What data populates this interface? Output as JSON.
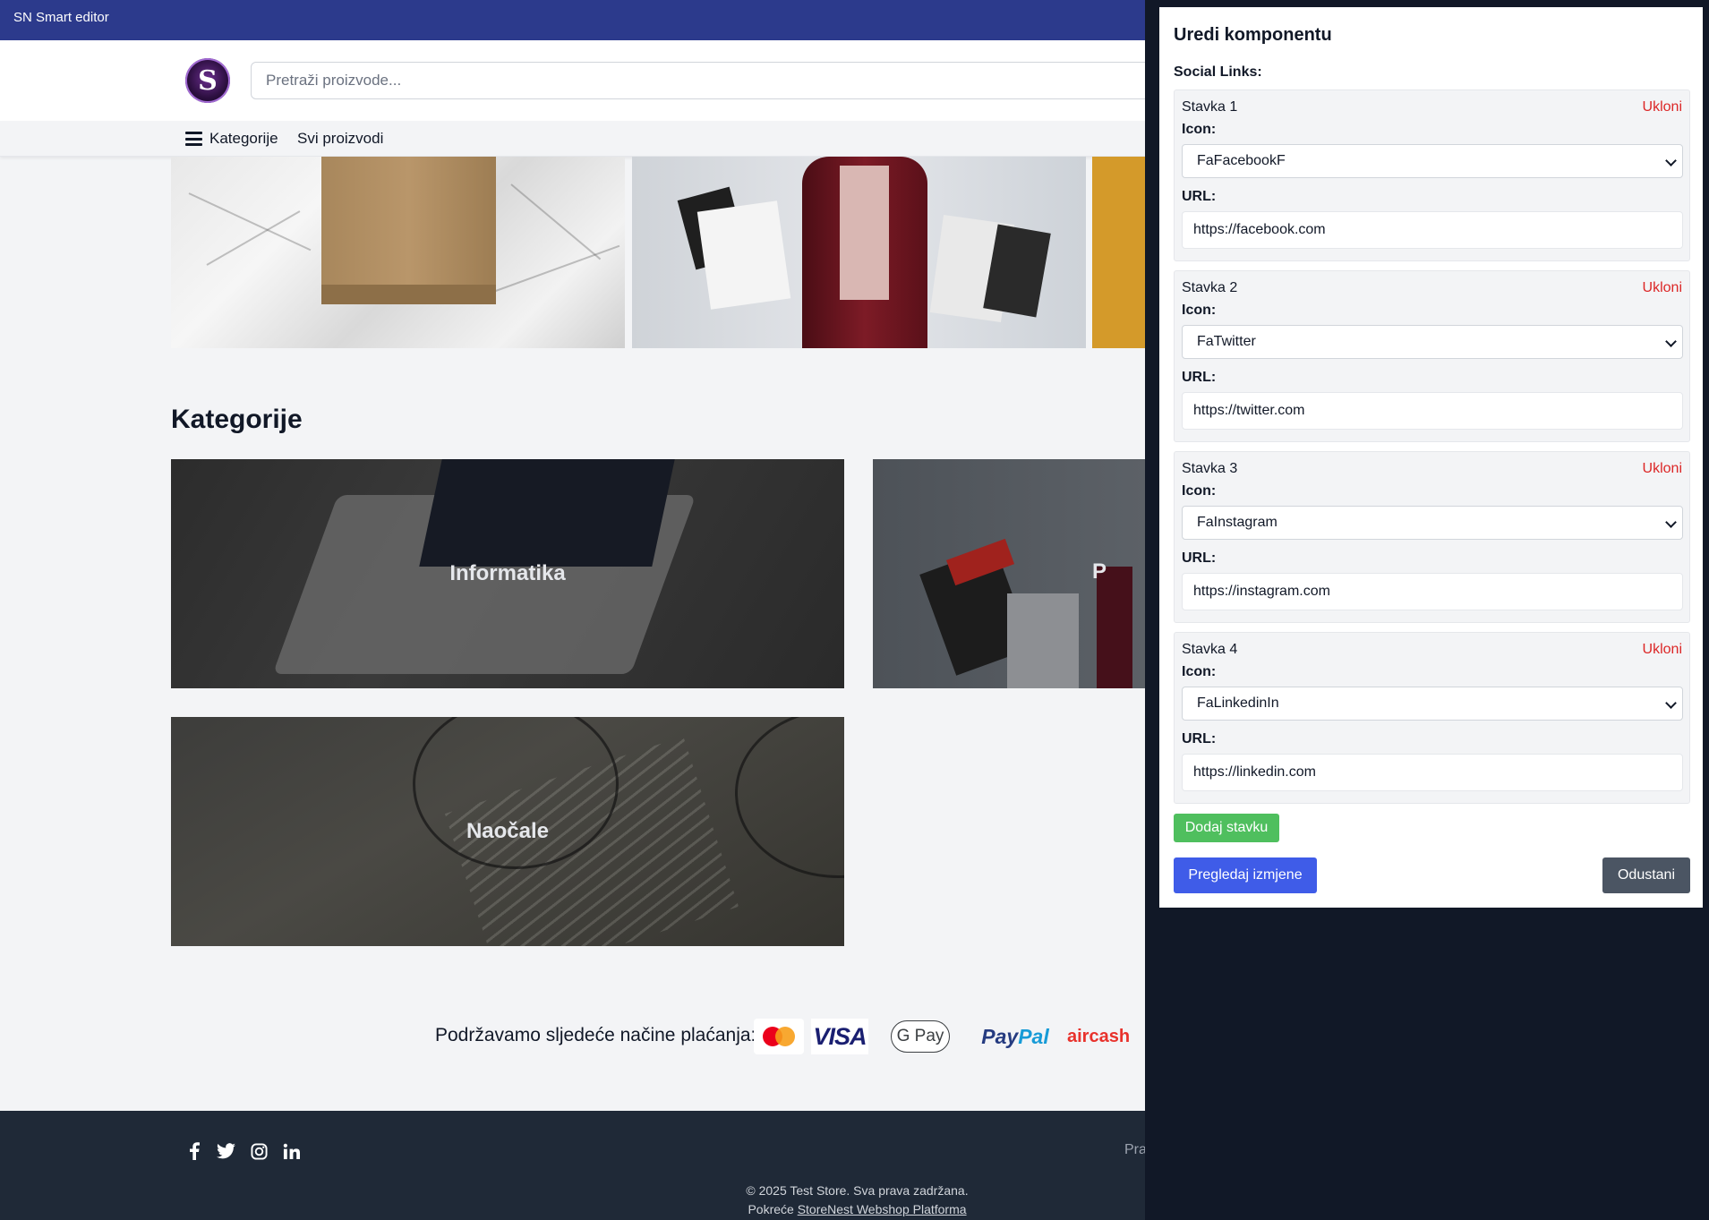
{
  "editor_bar": {
    "title": "SN Smart editor"
  },
  "header": {
    "logo_letter": "S",
    "search_placeholder": "Pretraži proizvode..."
  },
  "nav": {
    "categories_label": "Kategorije",
    "all_products_label": "Svi proizvodi"
  },
  "categories": {
    "title": "Kategorije",
    "items": [
      {
        "label": "Informatika"
      },
      {
        "label": "P"
      },
      {
        "label": "Naočale"
      }
    ]
  },
  "payment": {
    "text": "Podržavamo sljedeće načine plaćanja:",
    "methods": [
      {
        "name": "Mastercard",
        "icon": "mastercard-icon"
      },
      {
        "name": "VISA",
        "icon": "visa-icon"
      },
      {
        "name": "G Pay",
        "icon": "google-pay-icon"
      },
      {
        "name_part1": "Pay",
        "name_part2": "Pal",
        "icon": "paypal-icon"
      },
      {
        "name": "aircash",
        "icon": "aircash-icon"
      }
    ]
  },
  "footer": {
    "social_icons": [
      "facebook-icon",
      "twitter-icon",
      "instagram-icon",
      "linkedin-icon"
    ],
    "cut_link": "Pra",
    "copyright": "© 2025 Test Store. Sva prava zadržana.",
    "powered_prefix": "Pokreće ",
    "powered_link": "StoreNest Webshop Platforma"
  },
  "editor": {
    "title": "Uredi komponentu",
    "section_label": "Social Links:",
    "icon_label": "Icon:",
    "url_label": "URL:",
    "remove_label": "Ukloni",
    "items": [
      {
        "title": "Stavka 1",
        "icon": "FaFacebookF",
        "url": "https://facebook.com"
      },
      {
        "title": "Stavka 2",
        "icon": "FaTwitter",
        "url": "https://twitter.com"
      },
      {
        "title": "Stavka 3",
        "icon": "FaInstagram",
        "url": "https://instagram.com"
      },
      {
        "title": "Stavka 4",
        "icon": "FaLinkedinIn",
        "url": "https://linkedin.com"
      }
    ],
    "add_label": "Dodaj stavku",
    "preview_label": "Pregledaj izmjene",
    "cancel_label": "Odustani"
  },
  "colors": {
    "editor_bar": "#2c3a8c",
    "remove": "#dc2626",
    "add_button": "#4fbf5e",
    "preview_button": "#3f5ce8",
    "cancel_button": "#4b5563",
    "footer": "#1f2937",
    "overlay": "#111827"
  }
}
